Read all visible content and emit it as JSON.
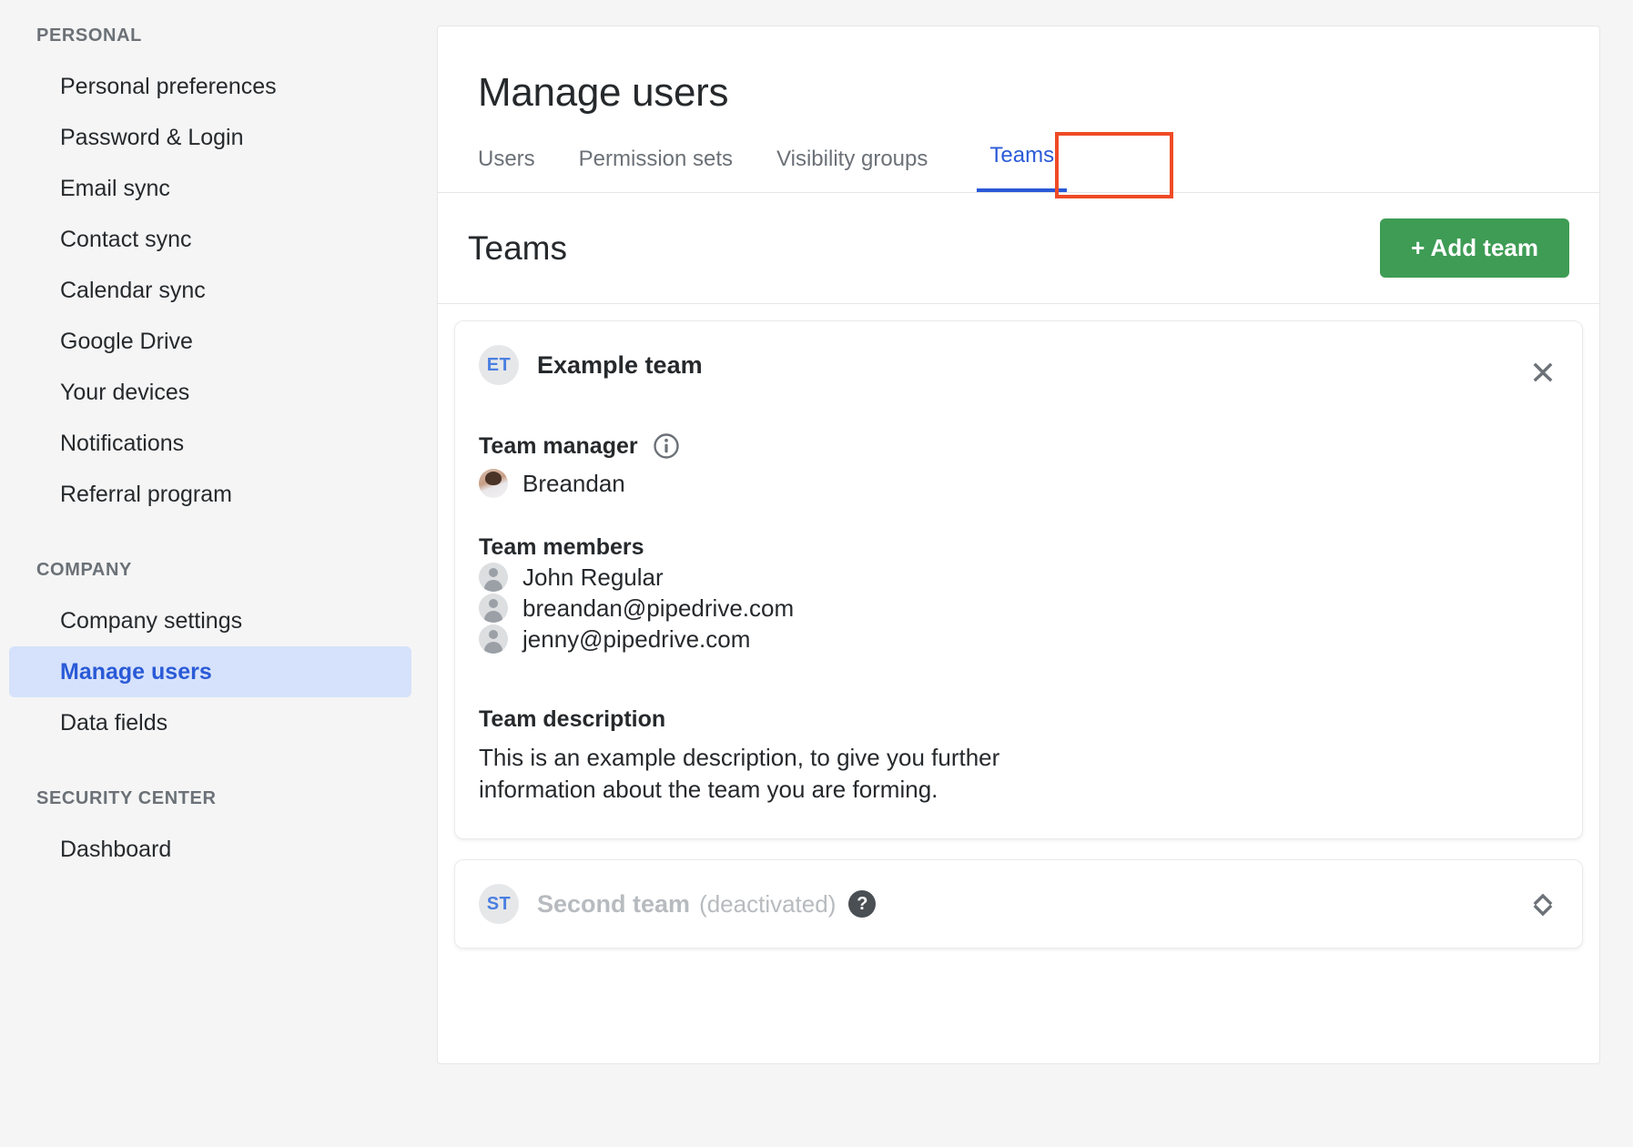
{
  "sidebar": {
    "groups": [
      {
        "title": "PERSONAL",
        "items": [
          {
            "label": "Personal preferences",
            "active": false
          },
          {
            "label": "Password & Login",
            "active": false
          },
          {
            "label": "Email sync",
            "active": false
          },
          {
            "label": "Contact sync",
            "active": false
          },
          {
            "label": "Calendar sync",
            "active": false
          },
          {
            "label": "Google Drive",
            "active": false
          },
          {
            "label": "Your devices",
            "active": false
          },
          {
            "label": "Notifications",
            "active": false
          },
          {
            "label": "Referral program",
            "active": false
          }
        ]
      },
      {
        "title": "COMPANY",
        "items": [
          {
            "label": "Company settings",
            "active": false
          },
          {
            "label": "Manage users",
            "active": true
          },
          {
            "label": "Data fields",
            "active": false
          }
        ]
      },
      {
        "title": "SECURITY CENTER",
        "items": [
          {
            "label": "Dashboard",
            "active": false
          }
        ]
      }
    ]
  },
  "header": {
    "title": "Manage users",
    "tabs": [
      {
        "label": "Users",
        "active": false
      },
      {
        "label": "Permission sets",
        "active": false
      },
      {
        "label": "Visibility groups",
        "active": false
      },
      {
        "label": "Teams",
        "active": true
      }
    ],
    "highlighted_tab": "Teams"
  },
  "teams_section": {
    "heading": "Teams",
    "add_button_label": "+ Add team",
    "teams": [
      {
        "initials": "ET",
        "name": "Example team",
        "expanded": true,
        "toggle_icon": "collapse-icon",
        "manager_label": "Team manager",
        "manager_info_icon": "info-icon",
        "manager": {
          "name": "Breandan",
          "avatar": "photo-avatar"
        },
        "members_label": "Team members",
        "members": [
          {
            "name": "John Regular",
            "avatar": "generic-person-avatar"
          },
          {
            "name": "breandan@pipedrive.com",
            "avatar": "generic-person-avatar"
          },
          {
            "name": "jenny@pipedrive.com",
            "avatar": "generic-person-avatar"
          }
        ],
        "description_label": "Team description",
        "description": "This is an example description, to give you further information about the team you are forming."
      },
      {
        "initials": "ST",
        "name": "Second team",
        "status": "(deactivated)",
        "help_badge": "?",
        "expanded": false,
        "toggle_icon": "expand-icon"
      }
    ]
  },
  "colors": {
    "accent_blue": "#2a5ad7",
    "green_button": "#3e9c54",
    "highlight_red": "#ef4a26",
    "sidebar_active_bg": "#d6e2fb"
  }
}
